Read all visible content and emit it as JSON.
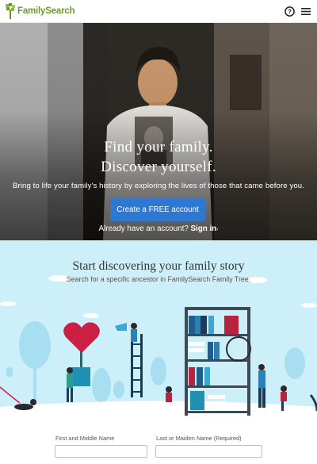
{
  "header": {
    "logo_text": "FamilySearch",
    "help_icon": "help-circle-icon",
    "menu_icon": "hamburger-menu-icon"
  },
  "hero": {
    "title_line1": "Find your family.",
    "title_line2": "Discover yourself.",
    "subtitle": "Bring to life your family's history by exploring the lives of those that came before you.",
    "cta_label": "Create a FREE account",
    "signin_prompt": "Already have an account?",
    "signin_link": "Sign in"
  },
  "discover": {
    "title": "Start discovering your family story",
    "subtitle": "Search for a specific ancestor in FamilySearch Family Tree."
  },
  "search_form": {
    "first_name_label": "First and Middle Name",
    "last_name_label": "Last or Maiden Name (Required)"
  },
  "colors": {
    "brand_green": "#6b9b2a",
    "cta_blue": "#2f78d1",
    "illustration_bg": "#cdeffa"
  }
}
